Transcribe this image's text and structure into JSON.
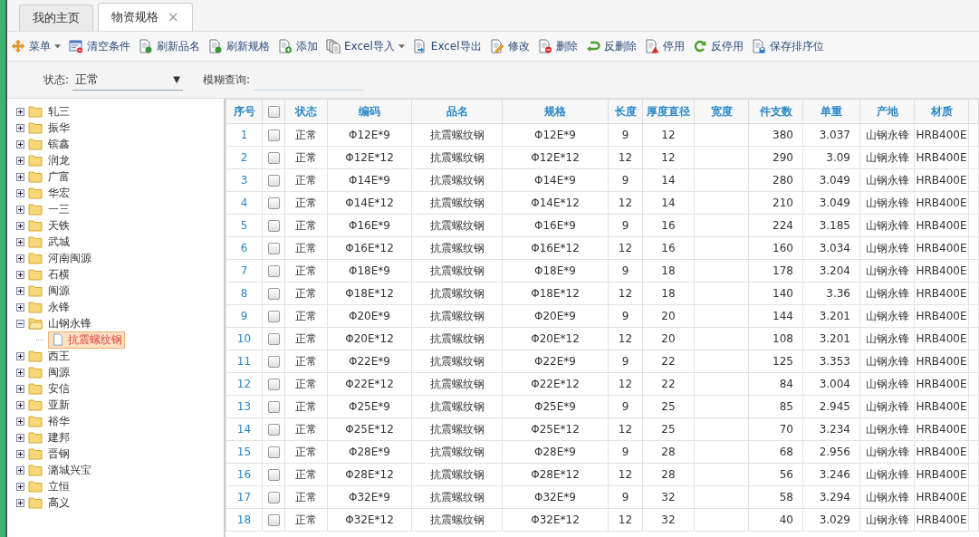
{
  "tabs": [
    {
      "label": "我的主页",
      "selected": false,
      "closable": false
    },
    {
      "label": "物资规格",
      "selected": true,
      "closable": true
    }
  ],
  "close_glyph": "×",
  "toolbar": [
    {
      "label": "菜单",
      "dropdown": true
    },
    {
      "label": "清空条件",
      "dropdown": false
    },
    {
      "label": "刷新品名",
      "dropdown": false
    },
    {
      "label": "刷新规格",
      "dropdown": false
    },
    {
      "label": "添加",
      "dropdown": false
    },
    {
      "label": "Excel导入",
      "dropdown": true
    },
    {
      "label": "Excel导出",
      "dropdown": false
    },
    {
      "label": "修改",
      "dropdown": false
    },
    {
      "label": "删除",
      "dropdown": false
    },
    {
      "label": "反删除",
      "dropdown": false
    },
    {
      "label": "停用",
      "dropdown": false
    },
    {
      "label": "反停用",
      "dropdown": false
    },
    {
      "label": "保存排序位",
      "dropdown": false
    }
  ],
  "filters": {
    "status_label": "状态:",
    "status_value": "正常",
    "dropdown_glyph": "▼",
    "search_label": "模糊查询:"
  },
  "tree": [
    {
      "label": "轧三",
      "kind": "folder",
      "expanded": false,
      "selected": false
    },
    {
      "label": "振华",
      "kind": "folder",
      "expanded": false,
      "selected": false
    },
    {
      "label": "镔鑫",
      "kind": "folder",
      "expanded": false,
      "selected": false
    },
    {
      "label": "润龙",
      "kind": "folder",
      "expanded": false,
      "selected": false
    },
    {
      "label": "广富",
      "kind": "folder",
      "expanded": false,
      "selected": false
    },
    {
      "label": "华宏",
      "kind": "folder",
      "expanded": false,
      "selected": false
    },
    {
      "label": "一三",
      "kind": "folder",
      "expanded": false,
      "selected": false
    },
    {
      "label": "天铁",
      "kind": "folder",
      "expanded": false,
      "selected": false
    },
    {
      "label": "武城",
      "kind": "folder",
      "expanded": false,
      "selected": false
    },
    {
      "label": "河南闽源",
      "kind": "folder",
      "expanded": false,
      "selected": false
    },
    {
      "label": "石横",
      "kind": "folder",
      "expanded": false,
      "selected": false
    },
    {
      "label": "闽源",
      "kind": "folder",
      "expanded": false,
      "selected": false
    },
    {
      "label": "永锋",
      "kind": "folder",
      "expanded": false,
      "selected": false
    },
    {
      "label": "山钢永锋",
      "kind": "folder",
      "expanded": true,
      "selected": false,
      "children": [
        {
          "label": "抗震螺纹钢",
          "kind": "file",
          "selected": true
        }
      ]
    },
    {
      "label": "西王",
      "kind": "folder",
      "expanded": false,
      "selected": false
    },
    {
      "label": "闽源",
      "kind": "folder",
      "expanded": false,
      "selected": false
    },
    {
      "label": "安信",
      "kind": "folder",
      "expanded": false,
      "selected": false
    },
    {
      "label": "亚新",
      "kind": "folder",
      "expanded": false,
      "selected": false
    },
    {
      "label": "裕华",
      "kind": "folder",
      "expanded": false,
      "selected": false
    },
    {
      "label": "建邦",
      "kind": "folder",
      "expanded": false,
      "selected": false
    },
    {
      "label": "晋钢",
      "kind": "folder",
      "expanded": false,
      "selected": false
    },
    {
      "label": "潞城兴宝",
      "kind": "folder",
      "expanded": false,
      "selected": false
    },
    {
      "label": "立恒",
      "kind": "folder",
      "expanded": false,
      "selected": false
    },
    {
      "label": "高义",
      "kind": "folder",
      "expanded": false,
      "selected": false
    }
  ],
  "table": {
    "columns": [
      "序号",
      "状态",
      "编码",
      "品名",
      "规格",
      "长度",
      "厚度直径",
      "宽度",
      "件支数",
      "单重",
      "产地",
      "材质"
    ],
    "all_checked": false,
    "rows": [
      {
        "no": "1",
        "checked": false,
        "status": "正常",
        "code": "Φ12E*9",
        "name": "抗震螺纹钢",
        "spec": "Φ12E*9",
        "length": "9",
        "diameter": "12",
        "count": "380",
        "weight": "3.037",
        "origin": "山钢永锋",
        "material": "HRB400E"
      },
      {
        "no": "2",
        "checked": false,
        "status": "正常",
        "code": "Φ12E*12",
        "name": "抗震螺纹钢",
        "spec": "Φ12E*12",
        "length": "12",
        "diameter": "12",
        "count": "290",
        "weight": "3.09",
        "origin": "山钢永锋",
        "material": "HRB400E"
      },
      {
        "no": "3",
        "checked": false,
        "status": "正常",
        "code": "Φ14E*9",
        "name": "抗震螺纹钢",
        "spec": "Φ14E*9",
        "length": "9",
        "diameter": "14",
        "count": "280",
        "weight": "3.049",
        "origin": "山钢永锋",
        "material": "HRB400E"
      },
      {
        "no": "4",
        "checked": false,
        "status": "正常",
        "code": "Φ14E*12",
        "name": "抗震螺纹钢",
        "spec": "Φ14E*12",
        "length": "12",
        "diameter": "14",
        "count": "210",
        "weight": "3.049",
        "origin": "山钢永锋",
        "material": "HRB400E"
      },
      {
        "no": "5",
        "checked": false,
        "status": "正常",
        "code": "Φ16E*9",
        "name": "抗震螺纹钢",
        "spec": "Φ16E*9",
        "length": "9",
        "diameter": "16",
        "count": "224",
        "weight": "3.185",
        "origin": "山钢永锋",
        "material": "HRB400E"
      },
      {
        "no": "6",
        "checked": false,
        "status": "正常",
        "code": "Φ16E*12",
        "name": "抗震螺纹钢",
        "spec": "Φ16E*12",
        "length": "12",
        "diameter": "16",
        "count": "160",
        "weight": "3.034",
        "origin": "山钢永锋",
        "material": "HRB400E"
      },
      {
        "no": "7",
        "checked": false,
        "status": "正常",
        "code": "Φ18E*9",
        "name": "抗震螺纹钢",
        "spec": "Φ18E*9",
        "length": "9",
        "diameter": "18",
        "count": "178",
        "weight": "3.204",
        "origin": "山钢永锋",
        "material": "HRB400E"
      },
      {
        "no": "8",
        "checked": false,
        "status": "正常",
        "code": "Φ18E*12",
        "name": "抗震螺纹钢",
        "spec": "Φ18E*12",
        "length": "12",
        "diameter": "18",
        "count": "140",
        "weight": "3.36",
        "origin": "山钢永锋",
        "material": "HRB400E"
      },
      {
        "no": "9",
        "checked": false,
        "status": "正常",
        "code": "Φ20E*9",
        "name": "抗震螺纹钢",
        "spec": "Φ20E*9",
        "length": "9",
        "diameter": "20",
        "count": "144",
        "weight": "3.201",
        "origin": "山钢永锋",
        "material": "HRB400E"
      },
      {
        "no": "10",
        "checked": false,
        "status": "正常",
        "code": "Φ20E*12",
        "name": "抗震螺纹钢",
        "spec": "Φ20E*12",
        "length": "12",
        "diameter": "20",
        "count": "108",
        "weight": "3.201",
        "origin": "山钢永锋",
        "material": "HRB400E"
      },
      {
        "no": "11",
        "checked": false,
        "status": "正常",
        "code": "Φ22E*9",
        "name": "抗震螺纹钢",
        "spec": "Φ22E*9",
        "length": "9",
        "diameter": "22",
        "count": "125",
        "weight": "3.353",
        "origin": "山钢永锋",
        "material": "HRB400E"
      },
      {
        "no": "12",
        "checked": false,
        "status": "正常",
        "code": "Φ22E*12",
        "name": "抗震螺纹钢",
        "spec": "Φ22E*12",
        "length": "12",
        "diameter": "22",
        "count": "84",
        "weight": "3.004",
        "origin": "山钢永锋",
        "material": "HRB400E"
      },
      {
        "no": "13",
        "checked": false,
        "status": "正常",
        "code": "Φ25E*9",
        "name": "抗震螺纹钢",
        "spec": "Φ25E*9",
        "length": "9",
        "diameter": "25",
        "count": "85",
        "weight": "2.945",
        "origin": "山钢永锋",
        "material": "HRB400E"
      },
      {
        "no": "14",
        "checked": false,
        "status": "正常",
        "code": "Φ25E*12",
        "name": "抗震螺纹钢",
        "spec": "Φ25E*12",
        "length": "12",
        "diameter": "25",
        "count": "70",
        "weight": "3.234",
        "origin": "山钢永锋",
        "material": "HRB400E"
      },
      {
        "no": "15",
        "checked": false,
        "status": "正常",
        "code": "Φ28E*9",
        "name": "抗震螺纹钢",
        "spec": "Φ28E*9",
        "length": "9",
        "diameter": "28",
        "count": "68",
        "weight": "2.956",
        "origin": "山钢永锋",
        "material": "HRB400E"
      },
      {
        "no": "16",
        "checked": false,
        "status": "正常",
        "code": "Φ28E*12",
        "name": "抗震螺纹钢",
        "spec": "Φ28E*12",
        "length": "12",
        "diameter": "28",
        "count": "56",
        "weight": "3.246",
        "origin": "山钢永锋",
        "material": "HRB400E"
      },
      {
        "no": "17",
        "checked": false,
        "status": "正常",
        "code": "Φ32E*9",
        "name": "抗震螺纹钢",
        "spec": "Φ32E*9",
        "length": "9",
        "diameter": "32",
        "count": "58",
        "weight": "3.294",
        "origin": "山钢永锋",
        "material": "HRB400E"
      },
      {
        "no": "18",
        "checked": false,
        "status": "正常",
        "code": "Φ32E*12",
        "name": "抗震螺纹钢",
        "spec": "Φ32E*12",
        "length": "12",
        "diameter": "32",
        "count": "40",
        "weight": "3.029",
        "origin": "山钢永锋",
        "material": "HRB400E"
      }
    ]
  }
}
